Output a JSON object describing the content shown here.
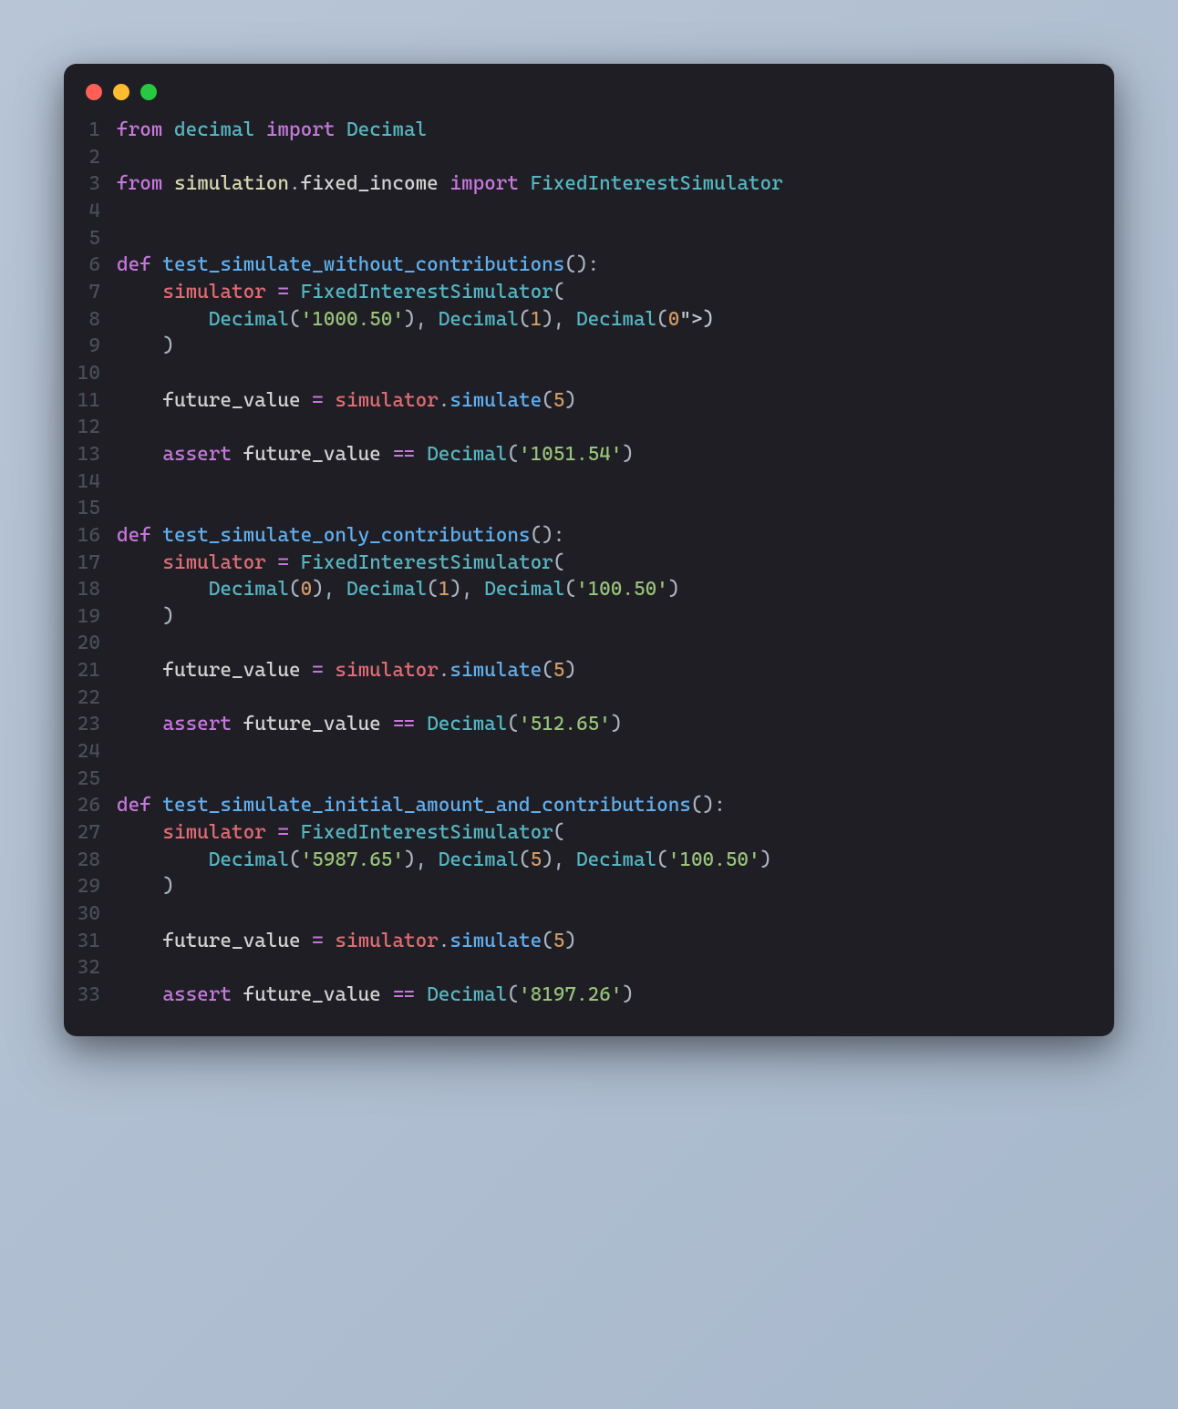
{
  "traffic_lights": {
    "red": "#ff5f57",
    "yellow": "#febc2e",
    "green": "#28c840"
  },
  "line_count": 33,
  "imports": {
    "kw_from_1": "from",
    "mod_decimal": "decimal",
    "kw_import_1": "import",
    "cls_decimal": "Decimal",
    "kw_from_2": "from",
    "mod_simulation": "simulation",
    "dot1": ".",
    "sub_fixed_income": "fixed_income",
    "kw_import_2": "import",
    "cls_simulator": "FixedInterestSimulator"
  },
  "kw_def": "def",
  "kw_assert": "assert",
  "op_eq": "=",
  "op_dbl_eq": "==",
  "var_simulator": "simulator",
  "var_future_value": "future_value",
  "method_simulate": "simulate",
  "cls_fix": "FixedInterestSimulator",
  "cls_dec": "Decimal",
  "tests": {
    "t1": {
      "name": "test_simulate_without_contributions",
      "args": {
        "a1": "'1000.50'",
        "a2": "1",
        "a3": "0"
      },
      "sim_arg": "5",
      "expected": "'1051.54'"
    },
    "t2": {
      "name": "test_simulate_only_contributions",
      "args": {
        "a1": "0",
        "a2": "1",
        "a3": "'100.50'"
      },
      "sim_arg": "5",
      "expected": "'512.65'"
    },
    "t3": {
      "name": "test_simulate_initial_amount_and_contributions",
      "args": {
        "a1": "'5987.65'",
        "a2": "5",
        "a3": "'100.50'"
      },
      "sim_arg": "5",
      "expected": "'8197.26'"
    }
  },
  "line_numbers": {
    "n1": "1",
    "n2": "2",
    "n3": "3",
    "n4": "4",
    "n5": "5",
    "n6": "6",
    "n7": "7",
    "n8": "8",
    "n9": "9",
    "n10": "10",
    "n11": "11",
    "n12": "12",
    "n13": "13",
    "n14": "14",
    "n15": "15",
    "n16": "16",
    "n17": "17",
    "n18": "18",
    "n19": "19",
    "n20": "20",
    "n21": "21",
    "n22": "22",
    "n23": "23",
    "n24": "24",
    "n25": "25",
    "n26": "26",
    "n27": "27",
    "n28": "28",
    "n29": "29",
    "n30": "30",
    "n31": "31",
    "n32": "32",
    "n33": "33"
  }
}
